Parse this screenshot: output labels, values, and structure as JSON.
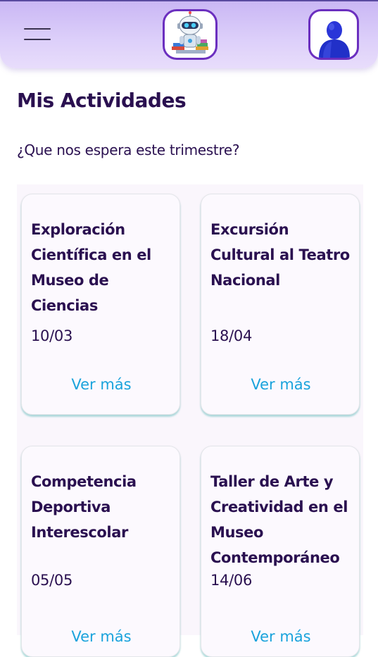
{
  "header": {
    "menu_icon": "hamburger-menu-icon",
    "logo_icon": "robot-mascot-logo-icon",
    "avatar_icon": "user-avatar-icon"
  },
  "page": {
    "title": "Mis Actividades",
    "subtitle": "¿Que nos espera este trimestre?"
  },
  "activities": [
    {
      "title": "Exploración Científica en el Museo de Ciencias",
      "date": "10/03",
      "more_label": "Ver más"
    },
    {
      "title": "Excursión Cultural al Teatro Nacional",
      "date": "18/04",
      "more_label": "Ver más"
    },
    {
      "title": "Competencia Deportiva Interescolar",
      "date": "05/05",
      "more_label": "Ver más"
    },
    {
      "title": "Taller de Arte y Creatividad en el Museo Contemporáneo",
      "date": "14/06",
      "more_label": "Ver más"
    }
  ],
  "colors": {
    "accent": "#6b2fbf",
    "text": "#2a1050",
    "link": "#1aa3dc"
  }
}
